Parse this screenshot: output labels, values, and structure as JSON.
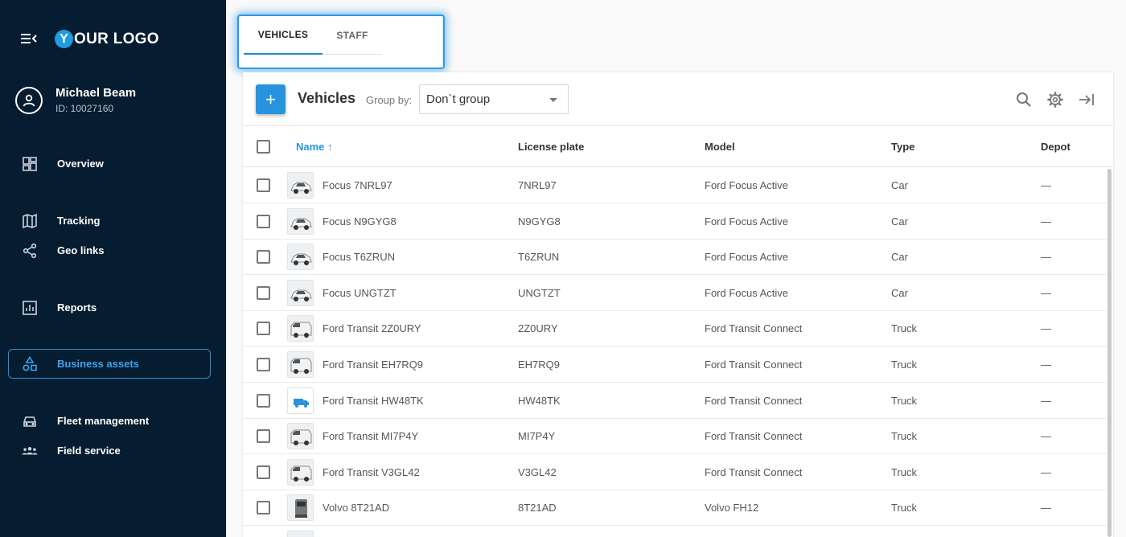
{
  "sidebar": {
    "logo": {
      "mark": "Y",
      "text": "OUR LOGO"
    },
    "user": {
      "name": "Michael Beam",
      "id": "ID: 10027160"
    },
    "nav": [
      {
        "label": "Overview",
        "icon": "dashboard-icon"
      },
      {
        "label": "Tracking",
        "icon": "map-icon"
      },
      {
        "label": "Geo links",
        "icon": "share-icon"
      },
      {
        "label": "Reports",
        "icon": "bar-chart-icon"
      },
      {
        "label": "Business assets",
        "icon": "shapes-icon",
        "active": true
      },
      {
        "label": "Fleet management",
        "icon": "car-icon"
      },
      {
        "label": "Field service",
        "icon": "group-icon"
      }
    ]
  },
  "tabs": [
    {
      "label": "VEHICLES",
      "active": true
    },
    {
      "label": "STAFF",
      "active": false
    }
  ],
  "toolbar": {
    "add_label": "+",
    "title": "Vehicles",
    "groupby_label": "Group by:",
    "groupby_value": "Don`t group",
    "icons": [
      "search-icon",
      "gear-icon",
      "collapse-right-icon"
    ]
  },
  "table": {
    "columns": [
      "Name",
      "License plate",
      "Model",
      "Type",
      "Depot"
    ],
    "sort_indicator": "↑",
    "rows": [
      {
        "name": "Focus 7NRL97",
        "plate": "7NRL97",
        "model": "Ford Focus Active",
        "type": "Car",
        "depot": "—"
      },
      {
        "name": "Focus N9GYG8",
        "plate": "N9GYG8",
        "model": "Ford Focus Active",
        "type": "Car",
        "depot": "—"
      },
      {
        "name": "Focus T6ZRUN",
        "plate": "T6ZRUN",
        "model": "Ford Focus Active",
        "type": "Car",
        "depot": "—"
      },
      {
        "name": "Focus UNGTZT",
        "plate": "UNGTZT",
        "model": "Ford Focus Active",
        "type": "Car",
        "depot": "—"
      },
      {
        "name": "Ford Transit 2Z0URY",
        "plate": "2Z0URY",
        "model": "Ford Transit Connect",
        "type": "Truck",
        "depot": "—"
      },
      {
        "name": "Ford Transit EH7RQ9",
        "plate": "EH7RQ9",
        "model": "Ford Transit Connect",
        "type": "Truck",
        "depot": "—"
      },
      {
        "name": "Ford Transit HW48TK",
        "plate": "HW48TK",
        "model": "Ford Transit Connect",
        "type": "Truck",
        "depot": "—"
      },
      {
        "name": "Ford Transit MI7P4Y",
        "plate": "MI7P4Y",
        "model": "Ford Transit Connect",
        "type": "Truck",
        "depot": "—"
      },
      {
        "name": "Ford Transit V3GL42",
        "plate": "V3GL42",
        "model": "Ford Transit Connect",
        "type": "Truck",
        "depot": "—"
      },
      {
        "name": "Volvo 8T21AD",
        "plate": "8T21AD",
        "model": "Volvo FH12",
        "type": "Truck",
        "depot": "—"
      }
    ]
  },
  "colors": {
    "sidebar_bg": "#061c30",
    "accent": "#2794dd"
  }
}
